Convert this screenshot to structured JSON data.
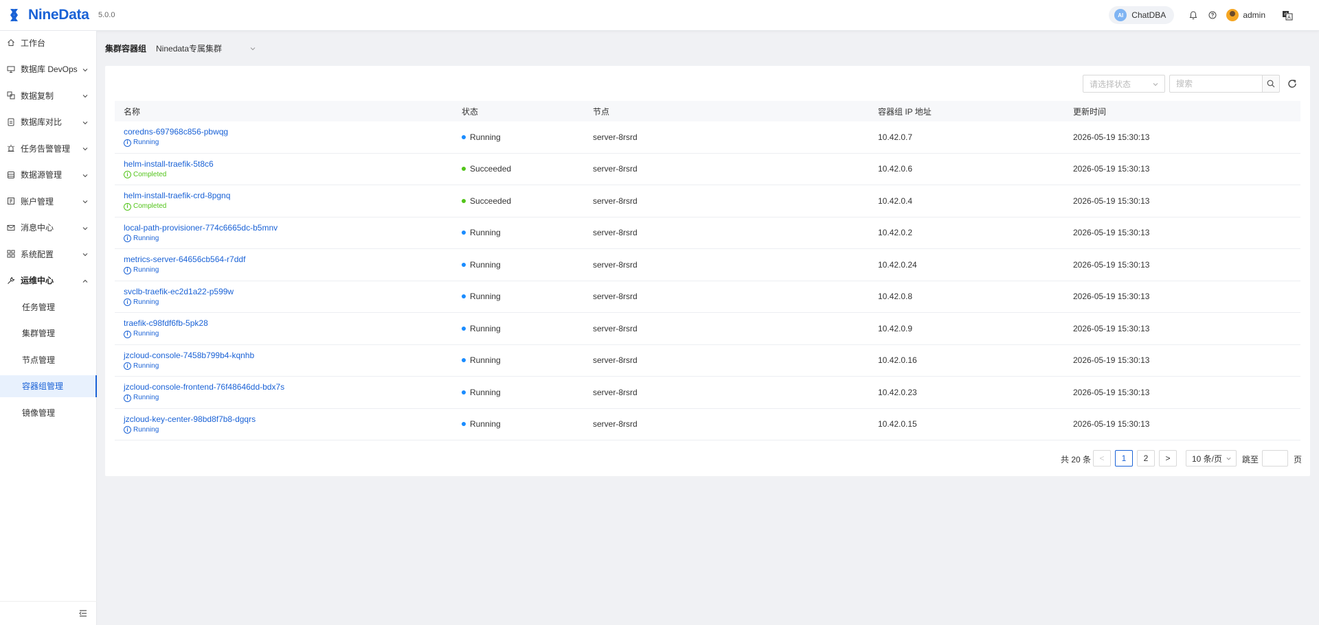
{
  "header": {
    "logo_text": "NineData",
    "version": "5.0.0",
    "chatdba_badge": "AI",
    "chatdba_label": "ChatDBA",
    "username": "admin"
  },
  "sidebar": {
    "items": [
      {
        "label": "工作台",
        "icon": "home-icon",
        "expandable": false
      },
      {
        "label": "数据库 DevOps",
        "icon": "devops-icon",
        "expandable": true
      },
      {
        "label": "数据复制",
        "icon": "replication-icon",
        "expandable": true
      },
      {
        "label": "数据库对比",
        "icon": "compare-icon",
        "expandable": true
      },
      {
        "label": "任务告警管理",
        "icon": "alarm-icon",
        "expandable": true
      },
      {
        "label": "数据源管理",
        "icon": "datasource-icon",
        "expandable": true
      },
      {
        "label": "账户管理",
        "icon": "account-icon",
        "expandable": true
      },
      {
        "label": "消息中心",
        "icon": "mail-icon",
        "expandable": true
      },
      {
        "label": "系统配置",
        "icon": "grid-icon",
        "expandable": true
      },
      {
        "label": "运维中心",
        "icon": "wrench-icon",
        "expandable": true,
        "expanded": true
      }
    ],
    "sub_items": [
      {
        "label": "任务管理",
        "active": false
      },
      {
        "label": "集群管理",
        "active": false
      },
      {
        "label": "节点管理",
        "active": false
      },
      {
        "label": "容器组管理",
        "active": true
      },
      {
        "label": "镜像管理",
        "active": false
      }
    ]
  },
  "cluster_bar": {
    "label": "集群容器组",
    "selected": "Ninedata专属集群"
  },
  "toolbar": {
    "status_placeholder": "请选择状态",
    "search_placeholder": "搜索"
  },
  "table": {
    "headers": [
      "名称",
      "状态",
      "节点",
      "容器组 IP 地址",
      "更新时间"
    ],
    "rows": [
      {
        "name": "coredns-697968c856-pbwqg",
        "phase": "Running",
        "phase_color": "#1a62d6",
        "state": "Running",
        "state_color": "#1a8cff",
        "node": "server-8rsrd",
        "ip": "10.42.0.7",
        "updated": "2026-05-19 15:30:13"
      },
      {
        "name": "helm-install-traefik-5t8c6",
        "phase": "Completed",
        "phase_color": "#52c41a",
        "state": "Succeeded",
        "state_color": "#52c41a",
        "node": "server-8rsrd",
        "ip": "10.42.0.6",
        "updated": "2026-05-19 15:30:13"
      },
      {
        "name": "helm-install-traefik-crd-8pgnq",
        "phase": "Completed",
        "phase_color": "#52c41a",
        "state": "Succeeded",
        "state_color": "#52c41a",
        "node": "server-8rsrd",
        "ip": "10.42.0.4",
        "updated": "2026-05-19 15:30:13"
      },
      {
        "name": "local-path-provisioner-774c6665dc-b5mnv",
        "phase": "Running",
        "phase_color": "#1a62d6",
        "state": "Running",
        "state_color": "#1a8cff",
        "node": "server-8rsrd",
        "ip": "10.42.0.2",
        "updated": "2026-05-19 15:30:13"
      },
      {
        "name": "metrics-server-64656cb564-r7ddf",
        "phase": "Running",
        "phase_color": "#1a62d6",
        "state": "Running",
        "state_color": "#1a8cff",
        "node": "server-8rsrd",
        "ip": "10.42.0.24",
        "updated": "2026-05-19 15:30:13"
      },
      {
        "name": "svclb-traefik-ec2d1a22-p599w",
        "phase": "Running",
        "phase_color": "#1a62d6",
        "state": "Running",
        "state_color": "#1a8cff",
        "node": "server-8rsrd",
        "ip": "10.42.0.8",
        "updated": "2026-05-19 15:30:13"
      },
      {
        "name": "traefik-c98fdf6fb-5pk28",
        "phase": "Running",
        "phase_color": "#1a62d6",
        "state": "Running",
        "state_color": "#1a8cff",
        "node": "server-8rsrd",
        "ip": "10.42.0.9",
        "updated": "2026-05-19 15:30:13"
      },
      {
        "name": "jzcloud-console-7458b799b4-kqnhb",
        "phase": "Running",
        "phase_color": "#1a62d6",
        "state": "Running",
        "state_color": "#1a8cff",
        "node": "server-8rsrd",
        "ip": "10.42.0.16",
        "updated": "2026-05-19 15:30:13"
      },
      {
        "name": "jzcloud-console-frontend-76f48646dd-bdx7s",
        "phase": "Running",
        "phase_color": "#1a62d6",
        "state": "Running",
        "state_color": "#1a8cff",
        "node": "server-8rsrd",
        "ip": "10.42.0.23",
        "updated": "2026-05-19 15:30:13"
      },
      {
        "name": "jzcloud-key-center-98bd8f7b8-dgqrs",
        "phase": "Running",
        "phase_color": "#1a62d6",
        "state": "Running",
        "state_color": "#1a8cff",
        "node": "server-8rsrd",
        "ip": "10.42.0.15",
        "updated": "2026-05-19 15:30:13"
      }
    ]
  },
  "pagination": {
    "total": "共 20 条",
    "prev": "<",
    "pages": [
      "1",
      "2"
    ],
    "current": "1",
    "next": ">",
    "page_size": "10 条/页",
    "jump_label": "跳至",
    "page_suffix": "页"
  },
  "colors": {
    "accent": "#1a62d6",
    "success": "#52c41a",
    "running_dot": "#1a8cff"
  }
}
